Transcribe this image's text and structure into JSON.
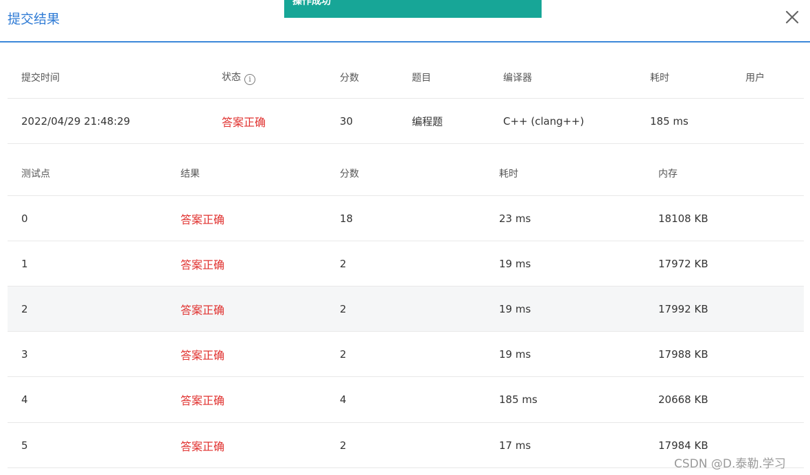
{
  "dialog": {
    "title": "提交结果",
    "close_icon": "close-icon"
  },
  "toast": {
    "message": "操作成功",
    "color": "#17a697"
  },
  "submission": {
    "headers": [
      "提交时间",
      "状态",
      "分数",
      "题目",
      "编译器",
      "耗时",
      "用户"
    ],
    "row": {
      "time": "2022/04/29 21:48:29",
      "status": "答案正确",
      "score": "30",
      "problem": "编程题",
      "compiler": "C++ (clang++)",
      "duration": "185 ms",
      "user": ""
    }
  },
  "tests": {
    "headers": [
      "测试点",
      "结果",
      "分数",
      "耗时",
      "内存"
    ],
    "rows": [
      {
        "id": "0",
        "result": "答案正确",
        "score": "18",
        "time": "23 ms",
        "memory": "18108 KB"
      },
      {
        "id": "1",
        "result": "答案正确",
        "score": "2",
        "time": "19 ms",
        "memory": "17972 KB"
      },
      {
        "id": "2",
        "result": "答案正确",
        "score": "2",
        "time": "19 ms",
        "memory": "17992 KB"
      },
      {
        "id": "3",
        "result": "答案正确",
        "score": "2",
        "time": "19 ms",
        "memory": "17988 KB"
      },
      {
        "id": "4",
        "result": "答案正确",
        "score": "4",
        "time": "185 ms",
        "memory": "20668 KB"
      },
      {
        "id": "5",
        "result": "答案正确",
        "score": "2",
        "time": "17 ms",
        "memory": "17984 KB"
      }
    ]
  },
  "watermark": "CSDN @D.泰勒.学习",
  "colors": {
    "accent": "#2f7bd5",
    "success_text": "#e0302e"
  }
}
